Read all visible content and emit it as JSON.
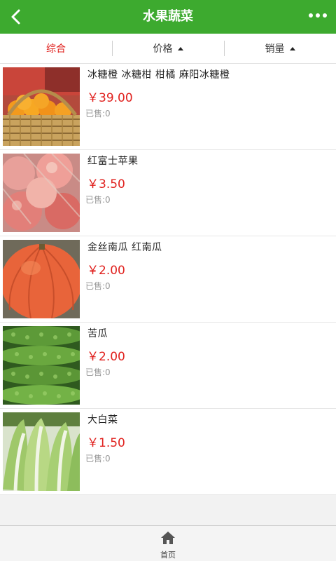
{
  "header": {
    "title": "水果蔬菜",
    "back_icon": "chevron-left-icon",
    "more_icon": "more-dots-icon"
  },
  "sortbar": {
    "items": [
      {
        "label": "综合",
        "active": true
      },
      {
        "label": "价格"
      },
      {
        "label": "销量"
      }
    ]
  },
  "products": [
    {
      "name": "冰糖橙 冰糖柑 柑橘 麻阳冰糖橙",
      "price": "￥39.00",
      "sold": "已售:0"
    },
    {
      "name": "红富士苹果",
      "price": "￥3.50",
      "sold": "已售:0"
    },
    {
      "name": "金丝南瓜 红南瓜",
      "price": "￥2.00",
      "sold": "已售:0"
    },
    {
      "name": "苦瓜",
      "price": "￥2.00",
      "sold": "已售:0"
    },
    {
      "name": "大白菜",
      "price": "￥1.50",
      "sold": "已售:0"
    }
  ],
  "tabbar": {
    "home_label": "首页",
    "home_icon": "home-icon"
  },
  "colors": {
    "header": "#3daa2f",
    "price": "#e0201d",
    "active_sort": "#e0201d"
  }
}
